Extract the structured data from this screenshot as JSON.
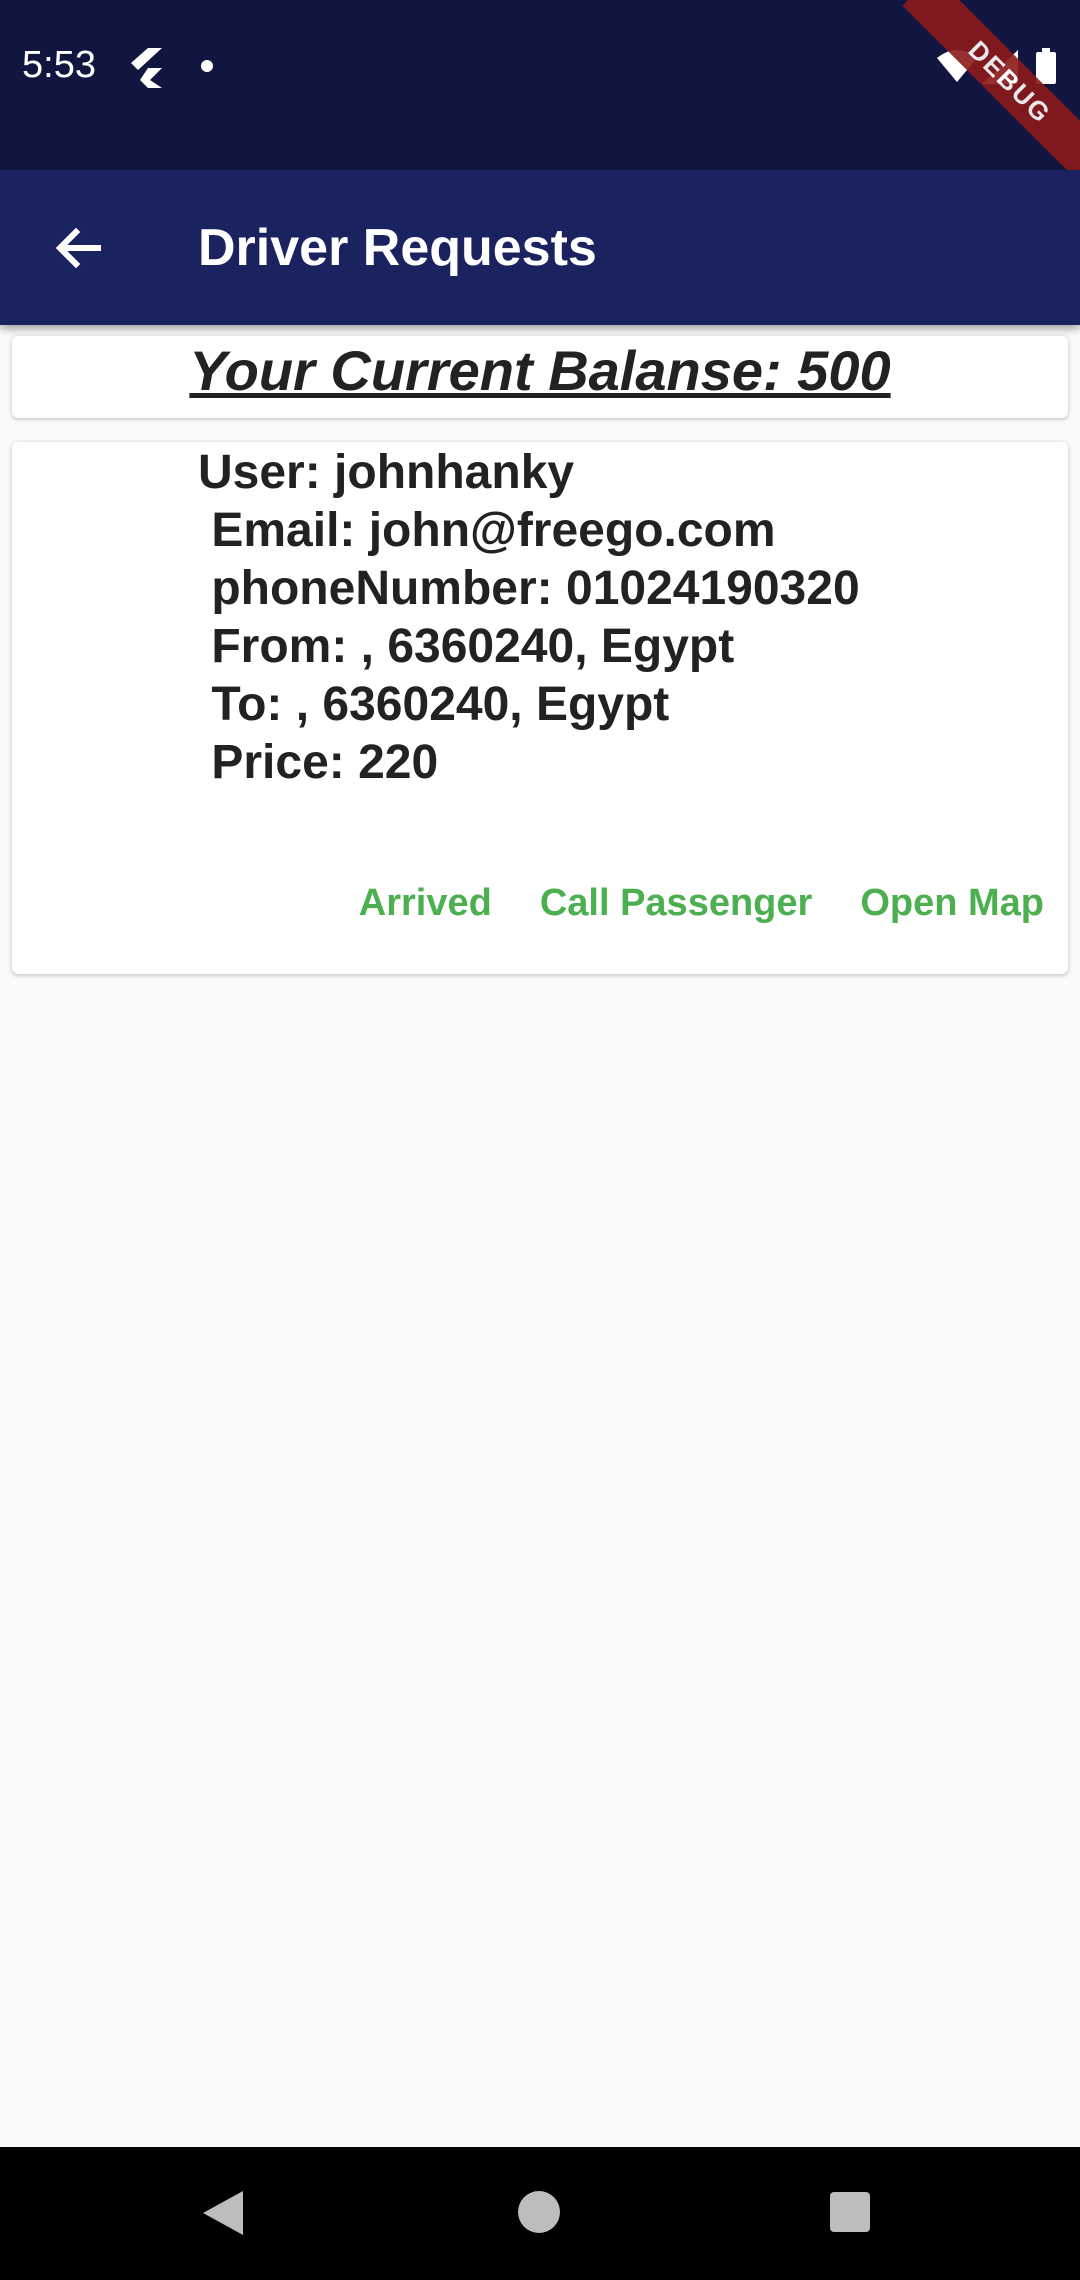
{
  "status_bar": {
    "time": "5:53",
    "icons": [
      "flutter-icon",
      "notification-dot-icon",
      "wifi-icon",
      "signal-icon",
      "battery-icon"
    ],
    "debug_label": "DEBUG"
  },
  "app_bar": {
    "title": "Driver Requests",
    "back_icon": "arrow-back-icon",
    "background_color": "#1a2260"
  },
  "balance": {
    "text": "Your Current Balanse: 500"
  },
  "request": {
    "user": "User: johnhanky",
    "email": " Email: john@freego.com",
    "phone": " phoneNumber: 01024190320",
    "from": " From: , 6360240, Egypt",
    "to": " To: , 6360240, Egypt",
    "price": " Price: 220",
    "actions": {
      "arrived": "Arrived",
      "call": "Call Passenger",
      "map": "Open Map"
    },
    "action_color": "#4caf50"
  },
  "nav_bar": {
    "icons": [
      "nav-back-icon",
      "nav-home-icon",
      "nav-recents-icon"
    ]
  }
}
